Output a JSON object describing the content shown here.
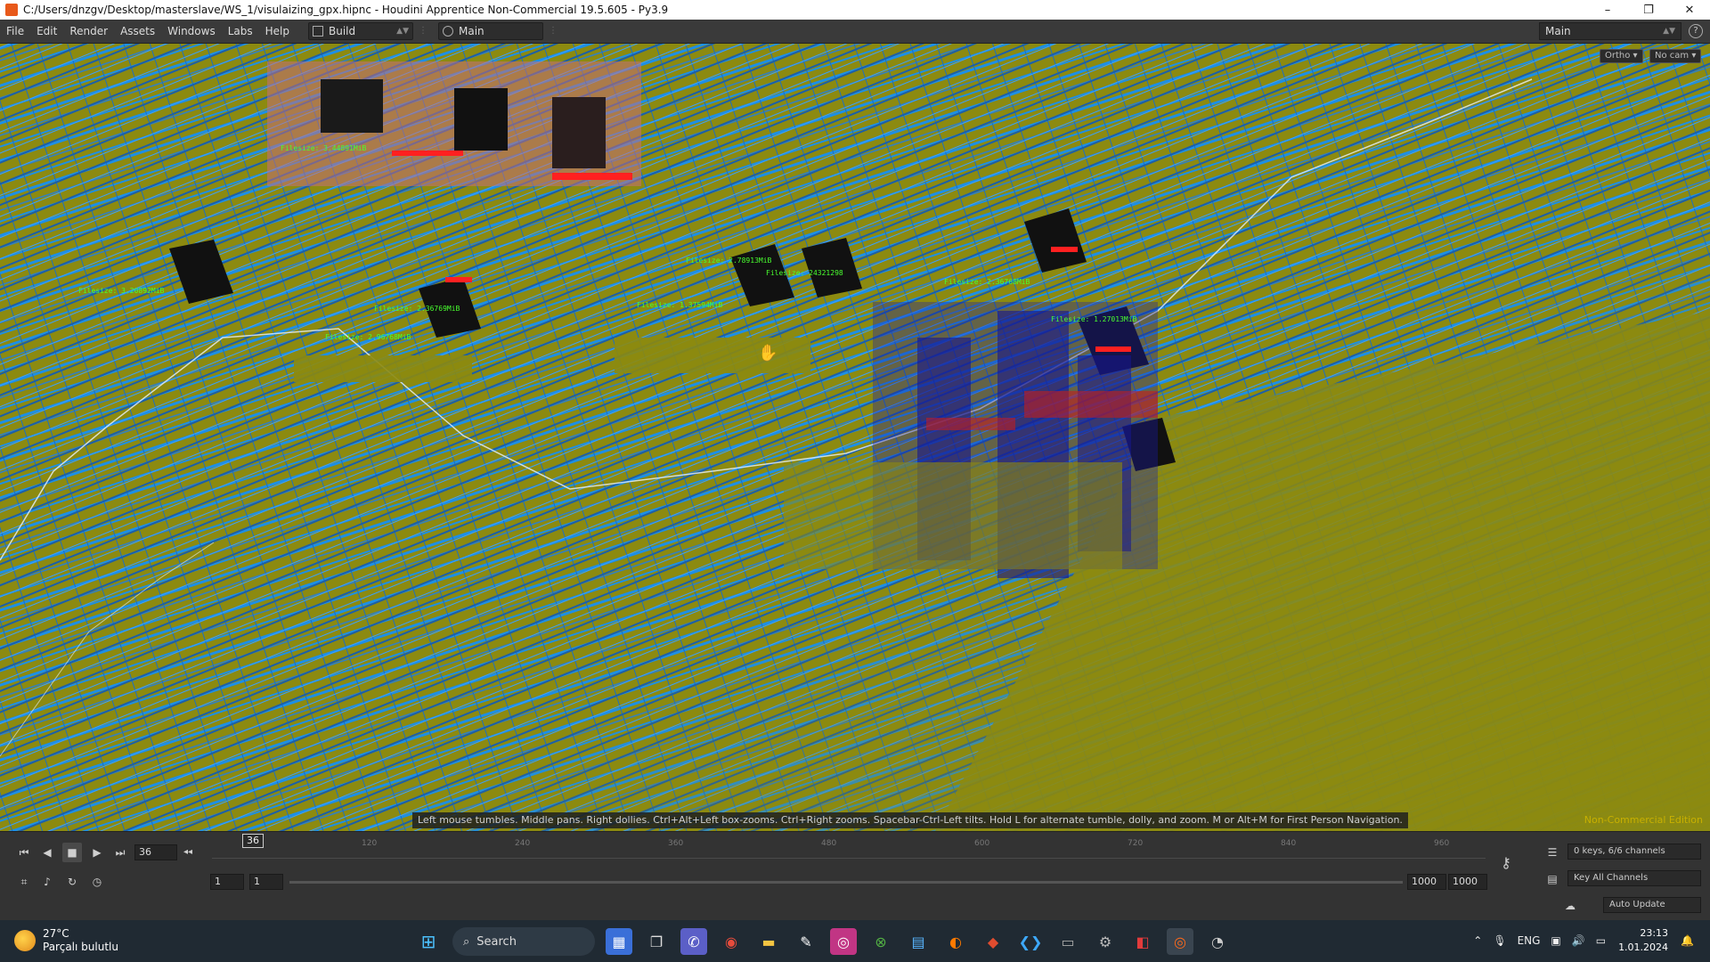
{
  "window": {
    "title": "C:/Users/dnzgv/Desktop/masterslave/WS_1/visulaizing_gpx.hipnc - Houdini Apprentice Non-Commercial 19.5.605 - Py3.9",
    "minimize": "–",
    "maximize": "❐",
    "close": "✕"
  },
  "menubar": {
    "items": [
      "File",
      "Edit",
      "Render",
      "Assets",
      "Windows",
      "Labs",
      "Help"
    ],
    "desktop_build": "Build",
    "desktop_main": "Main",
    "right_desktop": "Main",
    "help": "?"
  },
  "viewport": {
    "ortho_btn": "Ortho ▾",
    "cam_btn": "No cam ▾",
    "hint": "Left mouse tumbles. Middle pans. Right dollies. Ctrl+Alt+Left box-zooms. Ctrl+Right zooms. Spacebar-Ctrl-Left tilts. Hold L for alternate tumble, dolly, and zoom.    M or Alt+M for First Person Navigation.",
    "watermark": "Non-Commercial Edition",
    "labels": [
      "Filesize: 3.44891MiB",
      "Filesize: 2.36769MiB",
      "Filesize: 3.20892MiB",
      "Filesize: 2.96768MiB",
      "Filesize: 2.78913MiB",
      "Filesize: 1.37594MiB",
      "Filesize: 24321298",
      "Filesize: 1.27013MiB",
      "Filesize: 2.36768MiB"
    ],
    "colors": {
      "ground": "#8c8a10",
      "wire_blue": "#1d8fe6",
      "label_green": "#49ff2f",
      "label_red": "#ff2020"
    }
  },
  "timeline": {
    "current_frame": "36",
    "playhead": "36",
    "ruler_labels": [
      "120",
      "240",
      "360",
      "480",
      "600",
      "720",
      "840",
      "960"
    ],
    "start_frame": "1",
    "range_start": "1",
    "range_end": "1000",
    "end_frame": "1000",
    "keys_status": "0 keys, 6/6 channels",
    "key_all": "Key All Channels",
    "auto_update": "Auto Update"
  },
  "taskbar": {
    "weather_temp": "27°C",
    "weather_desc": "Parçalı bulutlu",
    "search": "Search",
    "lang": "ENG",
    "time": "23:13",
    "date": "1.01.2024"
  }
}
